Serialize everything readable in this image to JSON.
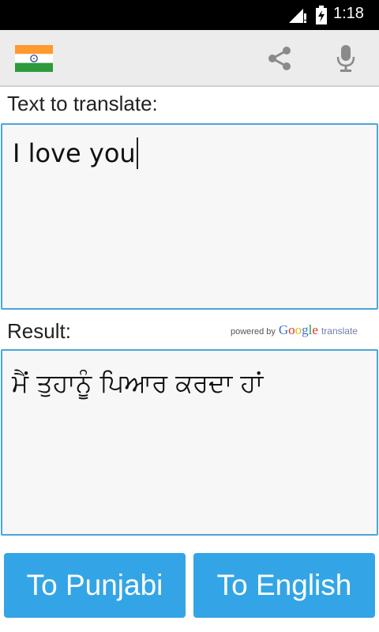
{
  "status_bar": {
    "time": "1:18"
  },
  "action_bar": {
    "flag_icon": "india-flag-icon",
    "share_icon": "share-icon",
    "mic_icon": "microphone-icon"
  },
  "input": {
    "label": "Text to translate:",
    "value": "I love you"
  },
  "result": {
    "label": "Result:",
    "powered_by": "powered by",
    "google": "Google",
    "translate": "translate",
    "value": "ਮੈਂ ਤੁਹਾਨੂੰ ਪਿਆਰ ਕਰਦਾ ਹਾਂ"
  },
  "buttons": {
    "to_target": "To Punjabi",
    "to_source": "To English"
  },
  "colors": {
    "accent": "#33a5e6",
    "box_border": "#4aa6d8",
    "action_bar": "#ececec"
  }
}
